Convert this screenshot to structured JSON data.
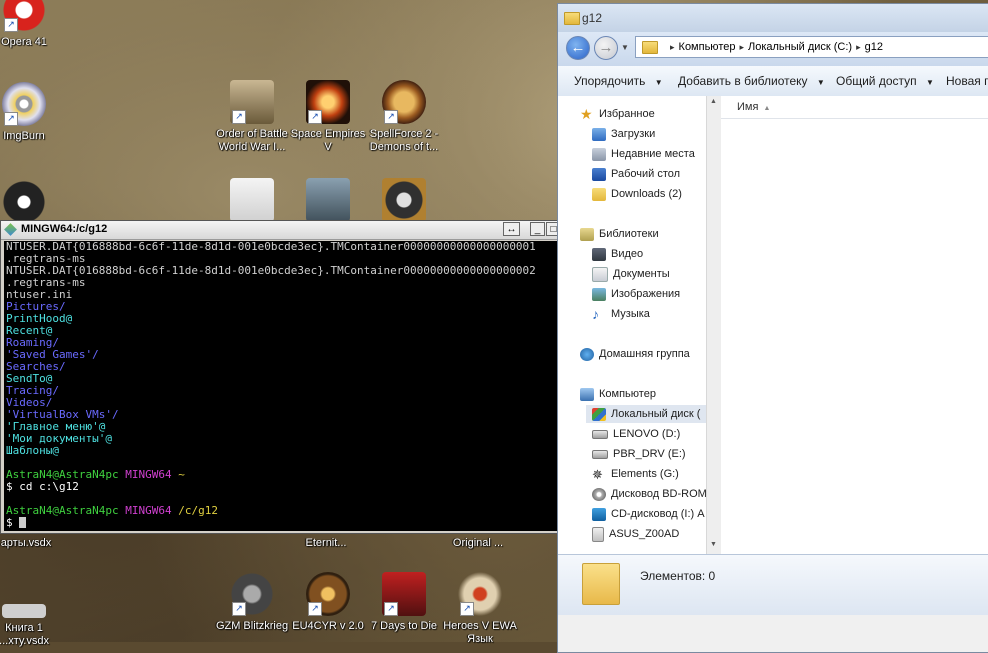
{
  "desktop_icons": [
    {
      "label": "Opera 41",
      "color": "#d8231d"
    },
    {
      "label": "ImgBurn",
      "color": "#c0c0c8"
    },
    {
      "label": "Order of Battle World War I...",
      "color": "#8b7a5a"
    },
    {
      "label": "Space Empires V",
      "color": "#6b3a12"
    },
    {
      "label": "SpellForce 2 - Demons of t...",
      "color": "#b88c2a"
    },
    {
      "label": "арты.vsdx",
      "color": "#3a3a3a"
    },
    {
      "label": "Eternit...",
      "color": "#3a3a3a"
    },
    {
      "label": "Original ...",
      "color": "#3a3a3a"
    },
    {
      "label": "GZM Blitzkrieg",
      "color": "#555555"
    },
    {
      "label": "EU4CYR v 2.0",
      "color": "#7a4a12"
    },
    {
      "label": "7 Days to Die",
      "color": "#b02020"
    },
    {
      "label": "Heroes V EWA Язык",
      "color": "#c0a070"
    },
    {
      "label": "Книга 1 ...xту.vsdx",
      "color": "#cfcfcf"
    }
  ],
  "terminal": {
    "title": "MINGW64:/c/g12",
    "lines": [
      {
        "text": "NTUSER.DAT{016888bd-6c6f-11de-8d1d-001e0bcde3ec}.TMContainer00000000000000000001",
        "color": "default"
      },
      {
        "text": ".regtrans-ms",
        "color": "default"
      },
      {
        "text": "NTUSER.DAT{016888bd-6c6f-11de-8d1d-001e0bcde3ec}.TMContainer00000000000000000002",
        "color": "default"
      },
      {
        "text": ".regtrans-ms",
        "color": "default"
      },
      {
        "text": "ntuser.ini",
        "color": "default"
      },
      {
        "text": "Pictures/",
        "color": "blue"
      },
      {
        "text": "PrintHood@",
        "color": "cyan"
      },
      {
        "text": "Recent@",
        "color": "cyan"
      },
      {
        "text": "Roaming/",
        "color": "blue"
      },
      {
        "text": "'Saved Games'/",
        "color": "blue"
      },
      {
        "text": "Searches/",
        "color": "blue"
      },
      {
        "text": "SendTo@",
        "color": "cyan"
      },
      {
        "text": "Tracing/",
        "color": "blue"
      },
      {
        "text": "Videos/",
        "color": "blue"
      },
      {
        "text": "'VirtualBox VMs'/",
        "color": "blue"
      },
      {
        "text": "'Главное меню'@",
        "color": "cyan"
      },
      {
        "text": "'Мои документы'@",
        "color": "cyan"
      },
      {
        "text": "Шаблоны@",
        "color": "cyan"
      },
      {
        "text": "",
        "color": "default"
      }
    ],
    "prompt1": {
      "user": "AstraN4@AstraN4pc",
      "shell": "MINGW64",
      "path": "~"
    },
    "command": "$ cd c:\\g12",
    "prompt2": {
      "user": "AstraN4@AstraN4pc",
      "shell": "MINGW64",
      "path": "/c/g12"
    },
    "cursor_line": "$ "
  },
  "explorer": {
    "title": "g12",
    "breadcrumb": [
      "Компьютер",
      "Локальный диск (C:)",
      "g12"
    ],
    "toolbar": [
      "Упорядочить",
      "Добавить в библиотеку",
      "Общий доступ",
      "Новая па"
    ],
    "nav": {
      "favorites": {
        "header": "Избранное",
        "items": [
          "Загрузки",
          "Недавние места",
          "Рабочий стол",
          "Downloads (2)"
        ]
      },
      "libraries": {
        "header": "Библиотеки",
        "items": [
          "Видео",
          "Документы",
          "Изображения",
          "Музыка"
        ]
      },
      "homegroup": "Домашняя группа",
      "computer": {
        "header": "Компьютер",
        "items": [
          "Локальный диск (",
          "LENOVO (D:)",
          "PBR_DRV (E:)",
          "Elements (G:)",
          "Дисковод BD-ROM",
          "CD-дисковод (I:) A",
          "ASUS_Z00AD"
        ]
      }
    },
    "column_name": "Имя",
    "status_text": "Элементов: 0"
  }
}
